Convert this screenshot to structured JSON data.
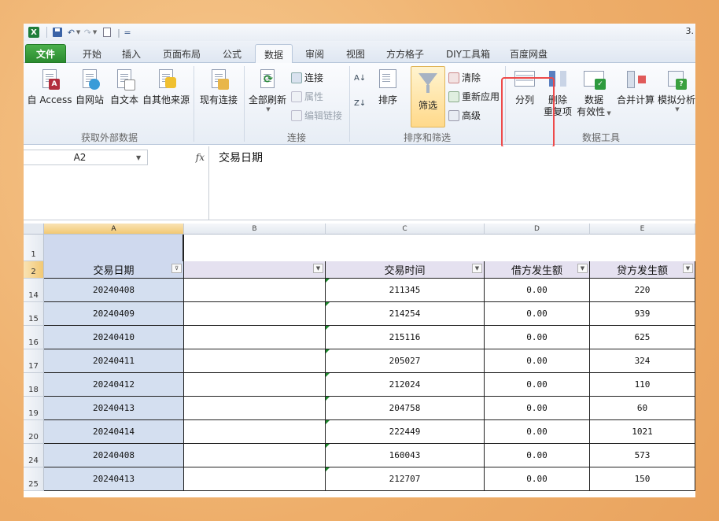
{
  "window": {
    "title_fragment": "3."
  },
  "qat": {
    "separator": "|",
    "more": "="
  },
  "tabs": [
    {
      "label": "文件"
    },
    {
      "label": "开始"
    },
    {
      "label": "插入"
    },
    {
      "label": "页面布局"
    },
    {
      "label": "公式"
    },
    {
      "label": "数据"
    },
    {
      "label": "审阅"
    },
    {
      "label": "视图"
    },
    {
      "label": "方方格子"
    },
    {
      "label": "DIY工具箱"
    },
    {
      "label": "百度网盘"
    }
  ],
  "ribbon": {
    "get_external": {
      "label": "获取外部数据",
      "access": "自 Access",
      "web": "自网站",
      "text": "自文本",
      "other": "自其他来源"
    },
    "existing_connections": "现有连接",
    "connections": {
      "label": "连接",
      "refresh_all": "全部刷新",
      "connections": "连接",
      "properties": "属性",
      "edit_links": "编辑链接"
    },
    "sort_filter": {
      "label": "排序和筛选",
      "sort": "排序",
      "filter": "筛选",
      "clear": "清除",
      "reapply": "重新应用",
      "advanced": "高级"
    },
    "data_tools": {
      "label": "数据工具",
      "text_to_columns": "分列",
      "remove_dup_1": "删除",
      "remove_dup_2": "重复项",
      "validation_1": "数据",
      "validation_2": "有效性",
      "consolidate": "合并计算",
      "what_if": "模拟分析"
    }
  },
  "formula_bar": {
    "name_box": "A2",
    "fx": "fx",
    "content": "交易日期"
  },
  "grid": {
    "columns": [
      "A",
      "B",
      "C",
      "D",
      "E"
    ],
    "header_row": [
      "交易日期",
      "",
      "交易时间",
      "借方发生额",
      "贷方发生额"
    ],
    "rows": [
      {
        "num": "14",
        "cells": [
          "20240408",
          "",
          "211345",
          "0.00",
          "220"
        ]
      },
      {
        "num": "15",
        "cells": [
          "20240409",
          "",
          "214254",
          "0.00",
          "939"
        ]
      },
      {
        "num": "16",
        "cells": [
          "20240410",
          "",
          "215116",
          "0.00",
          "625"
        ]
      },
      {
        "num": "17",
        "cells": [
          "20240411",
          "",
          "205027",
          "0.00",
          "324"
        ]
      },
      {
        "num": "18",
        "cells": [
          "20240412",
          "",
          "212024",
          "0.00",
          "110"
        ]
      },
      {
        "num": "19",
        "cells": [
          "20240413",
          "",
          "204758",
          "0.00",
          "60"
        ]
      },
      {
        "num": "20",
        "cells": [
          "20240414",
          "",
          "222449",
          "0.00",
          "1021"
        ]
      },
      {
        "num": "24",
        "cells": [
          "20240408",
          "",
          "160043",
          "0.00",
          "573"
        ]
      },
      {
        "num": "25",
        "cells": [
          "20240413",
          "",
          "212707",
          "0.00",
          "150"
        ]
      }
    ],
    "row_labels": {
      "r1": "1",
      "r2": "2"
    }
  }
}
